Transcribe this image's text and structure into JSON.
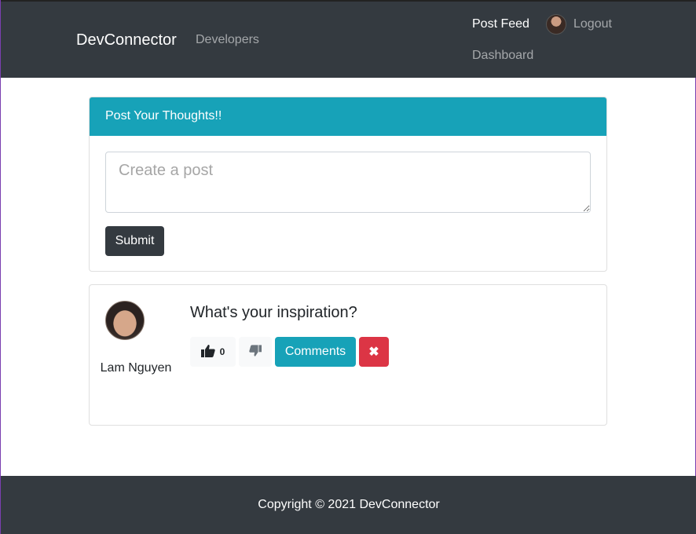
{
  "navbar": {
    "brand": "DevConnector",
    "developers": "Developers",
    "post_feed": "Post Feed",
    "logout": "Logout",
    "dashboard": "Dashboard"
  },
  "post_form": {
    "header": "Post Your Thoughts!!",
    "placeholder": "Create a post",
    "value": "",
    "submit_label": "Submit"
  },
  "post": {
    "author": "Lam Nguyen",
    "text": "What's your inspiration?",
    "likes": "0",
    "comments_label": "Comments",
    "delete_icon": "✖"
  },
  "footer": {
    "copyright": "Copyright © 2021 DevConnector"
  },
  "colors": {
    "navbar": "#343a40",
    "info": "#17a2b8",
    "danger": "#dc3545",
    "light": "#f8f9fa"
  }
}
